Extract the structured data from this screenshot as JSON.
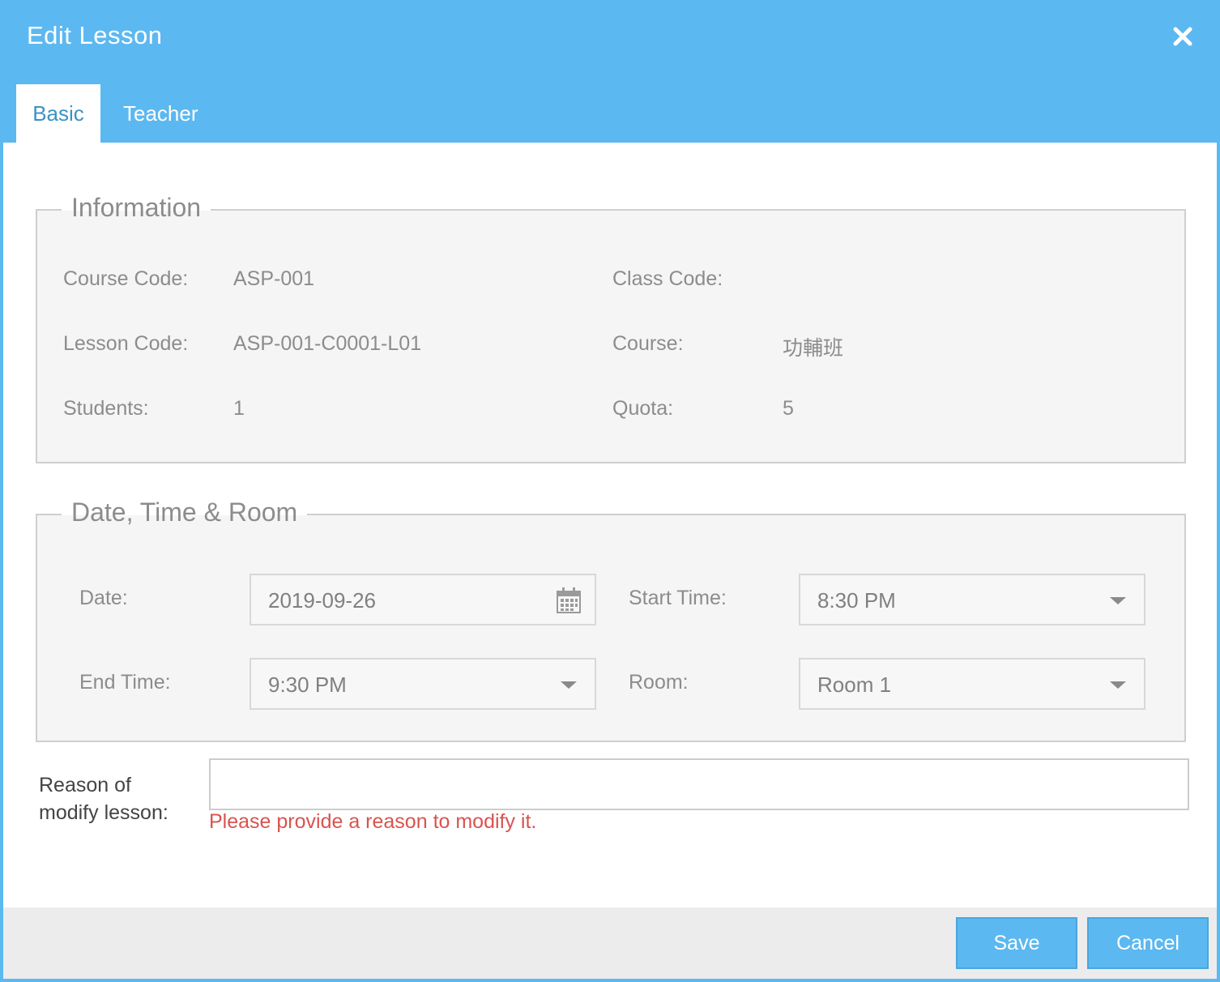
{
  "dialog": {
    "title": "Edit Lesson",
    "close_icon": "close-icon"
  },
  "tabs": [
    {
      "label": "Basic",
      "active": true
    },
    {
      "label": "Teacher",
      "active": false
    }
  ],
  "information": {
    "legend": "Information",
    "course_code_label": "Course Code:",
    "course_code": "ASP-001",
    "class_code_label": "Class Code:",
    "class_code": "",
    "lesson_code_label": "Lesson Code:",
    "lesson_code": "ASP-001-C0001-L01",
    "course_label": "Course:",
    "course": "功輔班",
    "students_label": "Students:",
    "students": "1",
    "quota_label": "Quota:",
    "quota": "5"
  },
  "schedule": {
    "legend": "Date, Time & Room",
    "date_label": "Date:",
    "date": "2019-09-26",
    "date_icon": "calendar-icon",
    "start_time_label": "Start Time:",
    "start_time": "8:30 PM",
    "end_time_label": "End Time:",
    "end_time": "9:30 PM",
    "room_label": "Room:",
    "room": "Room 1"
  },
  "reason": {
    "label_line1": "Reason of",
    "label_line2": "modify lesson:",
    "value": "",
    "error": "Please provide a reason to modify it."
  },
  "footer": {
    "save_label": "Save",
    "cancel_label": "Cancel"
  },
  "colors": {
    "accent": "#5cb8f0",
    "active_tab_text": "#3a93c4",
    "error": "#d9534f"
  }
}
